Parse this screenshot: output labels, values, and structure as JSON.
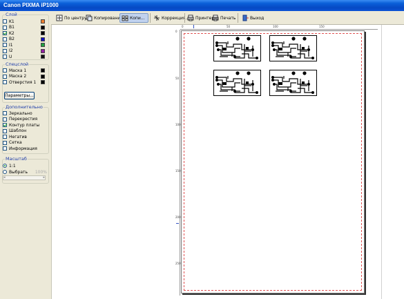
{
  "window": {
    "title": "Canon PIXMA iP1000"
  },
  "toolbar": {
    "buttons": [
      {
        "label": "По центру"
      },
      {
        "label": "Копирование"
      },
      {
        "label": "Копи..."
      },
      {
        "label": "Коррекция..."
      },
      {
        "label": "Принтер"
      },
      {
        "label": "Печать"
      },
      {
        "label": "Выход"
      }
    ]
  },
  "layers": {
    "title": "Слой",
    "items": [
      {
        "label": "K1",
        "checked": false,
        "color": "#f08030"
      },
      {
        "label": "B1",
        "checked": false,
        "color": "#000000"
      },
      {
        "label": "K2",
        "checked": true,
        "color": "#000000"
      },
      {
        "label": "B2",
        "checked": false,
        "color": "#1010c0"
      },
      {
        "label": "I1",
        "checked": false,
        "color": "#20a040"
      },
      {
        "label": "I2",
        "checked": false,
        "color": "#9020a0"
      },
      {
        "label": "U",
        "checked": false,
        "color": "#101010"
      }
    ]
  },
  "speclayer": {
    "title": "Спецслой",
    "items": [
      {
        "label": "Маска 1",
        "checked": false,
        "color": "#000000"
      },
      {
        "label": "Маска 2",
        "checked": false,
        "color": "#000000"
      },
      {
        "label": "Отверстия 1",
        "checked": false,
        "color": "#000000"
      }
    ],
    "params_button": "Параметры..."
  },
  "extra": {
    "title": "Дополнительно",
    "items": [
      {
        "label": "Зеркально",
        "checked": false
      },
      {
        "label": "Перекрестия",
        "checked": false
      },
      {
        "label": "Контур платы",
        "checked": true
      },
      {
        "label": "Шаблон",
        "checked": false
      },
      {
        "label": "Негатив",
        "checked": false
      },
      {
        "label": "Сетка",
        "checked": false
      },
      {
        "label": "Информация",
        "checked": false
      }
    ]
  },
  "scale": {
    "title": "Масштаб",
    "options": [
      {
        "label": "1:1",
        "selected": true
      },
      {
        "label": "Выбрать",
        "selected": false
      }
    ],
    "percent": "100%"
  },
  "ruler": {
    "top_labels": [
      "0",
      "50",
      "100",
      "150"
    ],
    "left_labels": [
      "0",
      "50",
      "100",
      "150",
      "200",
      "250"
    ]
  }
}
